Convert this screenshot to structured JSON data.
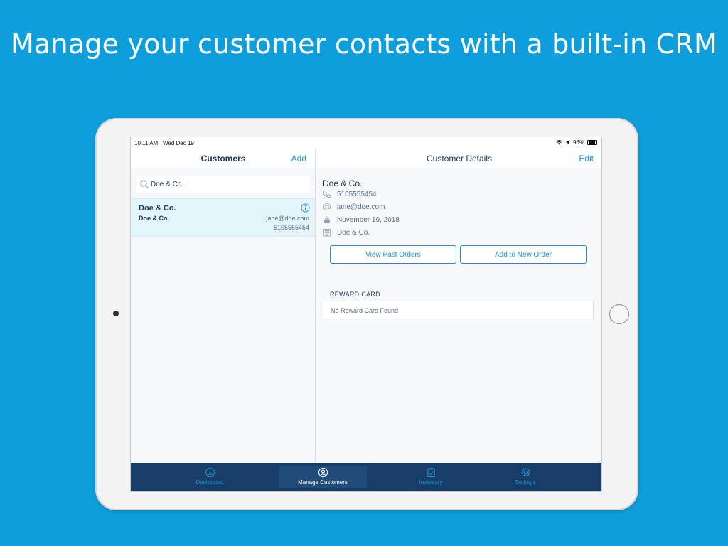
{
  "headline": "Manage your customer contacts with a built-in CRM",
  "status_bar": {
    "time": "10:11 AM",
    "date": "Wed Dec 19",
    "battery": "96%"
  },
  "left_pane": {
    "title": "Customers",
    "add_label": "Add",
    "search": {
      "value": "Doe & Co.",
      "placeholder": ""
    },
    "customers": [
      {
        "name": "Doe & Co.",
        "company": "Doe & Co.",
        "email": "jane@doe.com",
        "phone": "5105555454"
      }
    ]
  },
  "right_pane": {
    "title": "Customer Details",
    "edit_label": "Edit",
    "name": "Doe & Co.",
    "phone": "5105555454",
    "email": "jane@doe.com",
    "birthday": "November 19, 2018",
    "company": "Doe & Co.",
    "view_past_orders_label": "View Past Orders",
    "add_to_new_order_label": "Add to New Order",
    "reward_card_label": "REWARD CARD",
    "reward_card_value": "No Reward Card Found"
  },
  "tab_bar": {
    "tabs": [
      {
        "label": "Dashboard",
        "icon": "dashboard-icon"
      },
      {
        "label": "Manage Customers",
        "icon": "person-icon"
      },
      {
        "label": "Inventory",
        "icon": "clipboard-icon"
      },
      {
        "label": "Settings",
        "icon": "gear-icon"
      }
    ],
    "active_index": 1
  },
  "colors": {
    "background": "#0e9edb",
    "accent": "#1b8fdc",
    "navy": "#1d3557",
    "tab_bar": "#183d66",
    "selected_row": "#e4f4fb"
  }
}
